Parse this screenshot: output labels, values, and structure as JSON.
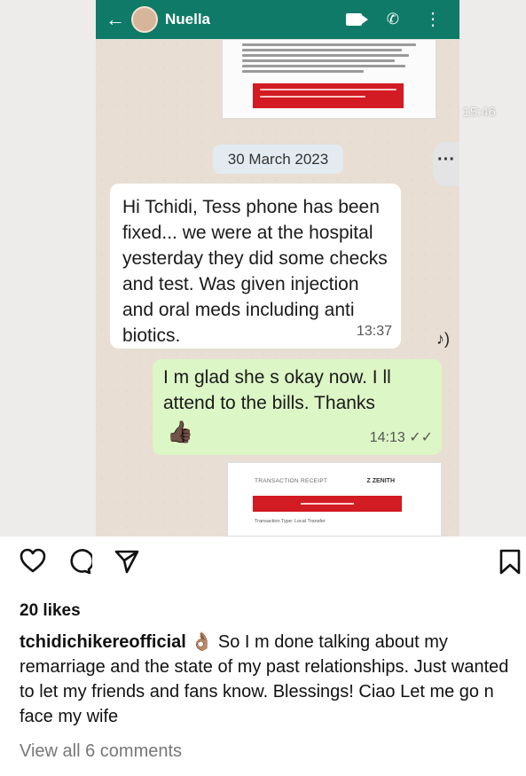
{
  "chat": {
    "contact_name": "Nuella",
    "top_receipt_time": "15:46",
    "date_divider": "30 March 2023",
    "more_icon": "ellipsis-icon",
    "incoming_message": {
      "text": "Hi Tchidi, Tess phone has been fixed... we were at the hospital yesterday they did some checks and test. Was given injection and oral meds including anti biotics.",
      "time": "13:37"
    },
    "outgoing_message": {
      "text": "I m glad she s okay now. I ll attend to the bills. Thanks",
      "emoji": "👍🏿",
      "time": "14:13 ✓✓"
    },
    "receipt": {
      "title": "TRANSACTION RECEIPT",
      "brand": "Z ZENITH",
      "type_label": "Transaction Type: Local Transfer"
    }
  },
  "post": {
    "likes": "20 likes",
    "username": "tchidichikereofficial",
    "emoji": "👌🏽",
    "caption": "So I m done talking about my remarriage and the state of my past relationships. Just wanted to let my friends and fans know. Blessings! Ciao Let me go n face my wife",
    "view_comments": "View all 6 comments"
  },
  "colors": {
    "header_green": "#0f7a68",
    "outgoing_bubble": "#dcf6c6",
    "receipt_red": "#d21b22"
  }
}
